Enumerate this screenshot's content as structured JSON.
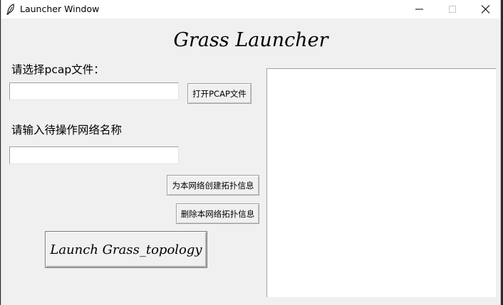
{
  "window": {
    "title": "Launcher Window"
  },
  "heading": "Grass Launcher",
  "pcap": {
    "label": "请选择pcap文件：",
    "value": "",
    "open_button": "打开PCAP文件"
  },
  "network": {
    "label": "请输入待操作网络名称",
    "value": "",
    "create_button": "为本网络创建拓扑信息",
    "delete_button": "删除本网络拓扑信息"
  },
  "launch_button": "Launch Grass_topology",
  "output_text": ""
}
